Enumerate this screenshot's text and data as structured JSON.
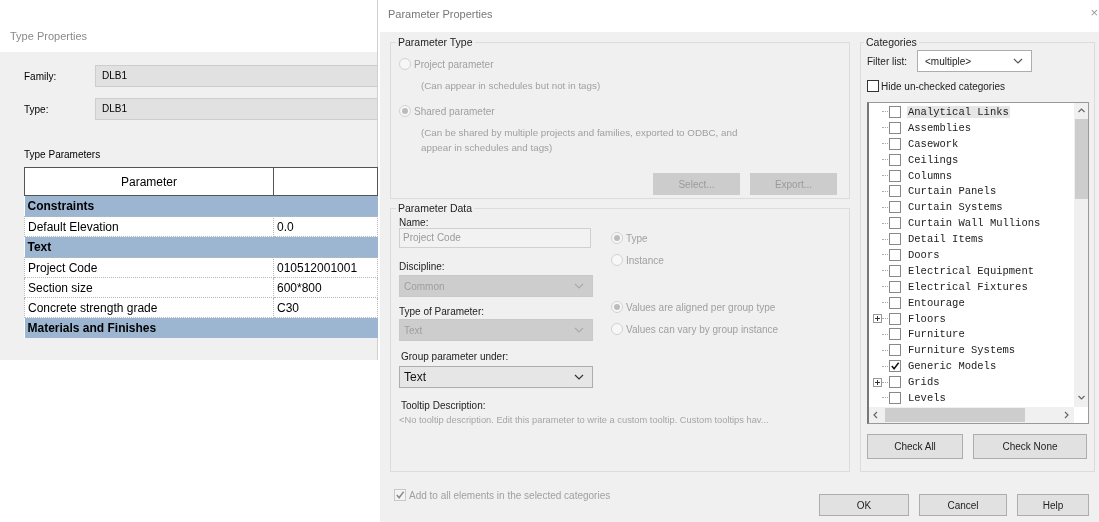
{
  "type_properties": {
    "title": "Type Properties",
    "fields": [
      {
        "label": "Family:",
        "value": "DLB1"
      },
      {
        "label": "Type:",
        "value": "DLB1"
      }
    ],
    "section_title": "Type Parameters",
    "table": {
      "columns": [
        "Parameter"
      ],
      "rows": [
        {
          "kind": "group",
          "label": "Constraints"
        },
        {
          "kind": "param",
          "name": "Default Elevation",
          "value": "0.0"
        },
        {
          "kind": "group",
          "label": "Text"
        },
        {
          "kind": "param",
          "name": "Project Code",
          "value": "010512001001"
        },
        {
          "kind": "param",
          "name": "Section size",
          "value": "600*800"
        },
        {
          "kind": "param",
          "name": "Concrete strength grade",
          "value": "C30"
        },
        {
          "kind": "group",
          "label": "Materials and Finishes"
        }
      ]
    }
  },
  "parameter_properties": {
    "title": "Parameter Properties",
    "close": "×",
    "parameter_type": {
      "title": "Parameter Type",
      "disabled": true,
      "options": [
        {
          "label": "Project parameter",
          "note": "(Can appear in schedules but not in tags)",
          "selected": false
        },
        {
          "label": "Shared parameter",
          "note": "(Can be shared by multiple projects and families, exported to ODBC, and appear in schedules and tags)",
          "selected": true
        }
      ],
      "buttons": [
        {
          "label": "Select...",
          "disabled": true
        },
        {
          "label": "Export...",
          "disabled": true
        }
      ]
    },
    "parameter_data": {
      "title": "Parameter Data",
      "name": {
        "label": "Name:",
        "value": "Project Code",
        "disabled": true
      },
      "discipline": {
        "label": "Discipline:",
        "value": "Common",
        "disabled": true
      },
      "type_of_parameter": {
        "label": "Type of Parameter:",
        "value": "Text",
        "disabled": true
      },
      "group_under": {
        "label": "Group parameter under:",
        "value": "Text",
        "disabled": false
      },
      "options_disabled": true,
      "scope_options": [
        {
          "label": "Type",
          "selected": true
        },
        {
          "label": "Instance",
          "selected": false
        }
      ],
      "group_options": [
        {
          "label": "Values are aligned per group type",
          "selected": true
        },
        {
          "label": "Values can vary by group instance",
          "selected": false
        }
      ],
      "tooltip": {
        "label": "Tooltip Description:",
        "text": "<No tooltip description. Edit this parameter to write a custom tooltip. Custom tooltips hav..."
      }
    },
    "add_to_all": {
      "label": "Add to all elements in the selected categories",
      "checked": true,
      "disabled": true
    },
    "categories": {
      "title": "Categories",
      "filter_label": "Filter list:",
      "filter_value": "<multiple>",
      "hide_unchecked": {
        "label": "Hide un-checked categories",
        "checked": false
      },
      "items": [
        {
          "label": "Analytical Links",
          "kind": "leaf",
          "checked": false,
          "selected": true
        },
        {
          "label": "Assemblies",
          "kind": "leaf",
          "checked": false,
          "selected": false
        },
        {
          "label": "Casework",
          "kind": "leaf",
          "checked": false,
          "selected": false
        },
        {
          "label": "Ceilings",
          "kind": "leaf",
          "checked": false,
          "selected": false
        },
        {
          "label": "Columns",
          "kind": "leaf",
          "checked": false,
          "selected": false
        },
        {
          "label": "Curtain Panels",
          "kind": "leaf",
          "checked": false,
          "selected": false
        },
        {
          "label": "Curtain Systems",
          "kind": "leaf",
          "checked": false,
          "selected": false
        },
        {
          "label": "Curtain Wall Mullions",
          "kind": "leaf",
          "checked": false,
          "selected": false
        },
        {
          "label": "Detail Items",
          "kind": "leaf",
          "checked": false,
          "selected": false
        },
        {
          "label": "Doors",
          "kind": "leaf",
          "checked": false,
          "selected": false
        },
        {
          "label": "Electrical Equipment",
          "kind": "leaf",
          "checked": false,
          "selected": false
        },
        {
          "label": "Electrical Fixtures",
          "kind": "leaf",
          "checked": false,
          "selected": false
        },
        {
          "label": "Entourage",
          "kind": "leaf",
          "checked": false,
          "selected": false
        },
        {
          "label": "Floors",
          "kind": "group",
          "checked": false,
          "selected": false
        },
        {
          "label": "Furniture",
          "kind": "leaf",
          "checked": false,
          "selected": false
        },
        {
          "label": "Furniture Systems",
          "kind": "leaf",
          "checked": false,
          "selected": false
        },
        {
          "label": "Generic Models",
          "kind": "leaf",
          "checked": true,
          "selected": false
        },
        {
          "label": "Grids",
          "kind": "group",
          "checked": false,
          "selected": false
        },
        {
          "label": "Levels",
          "kind": "leaf",
          "checked": false,
          "selected": false
        }
      ],
      "buttons": [
        "Check All",
        "Check None"
      ]
    },
    "buttons": [
      "OK",
      "Cancel",
      "Help"
    ]
  }
}
